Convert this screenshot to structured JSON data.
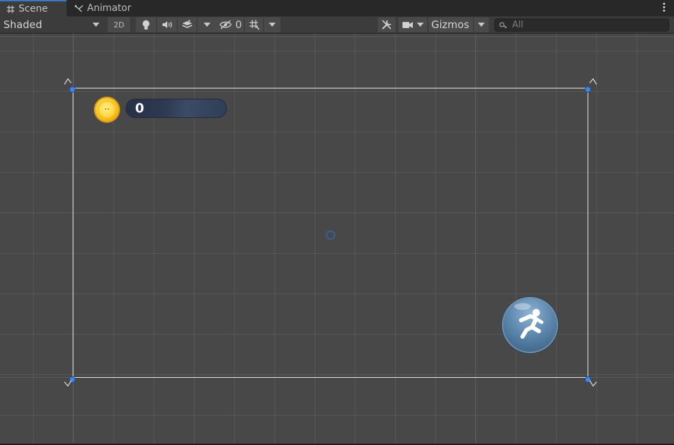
{
  "tabs": [
    {
      "label": "Scene",
      "icon": "grid-icon",
      "active": true
    },
    {
      "label": "Animator",
      "icon": "animator-icon",
      "active": false
    }
  ],
  "toolbar": {
    "shading_mode": "Shaded",
    "mode_2d_label": "2D",
    "hidden_count": "0",
    "gizmos_label": "Gizmos",
    "search_placeholder": "All"
  },
  "scene": {
    "coin_count": "0"
  },
  "colors": {
    "accent": "#3a79bb",
    "handle": "#3f86e8",
    "canvas_outline": "#e8e8e8",
    "coin": "#f7c21d",
    "counter_bg": "#2d3a52"
  },
  "icons": [
    "grid-icon",
    "animator-icon",
    "more-options-icon",
    "lightbulb-icon",
    "audio-icon",
    "effects-icon",
    "visibility-icon",
    "grid-snap-icon",
    "tools-icon",
    "camera-icon",
    "search-icon",
    "coin-icon",
    "jump-icon"
  ]
}
